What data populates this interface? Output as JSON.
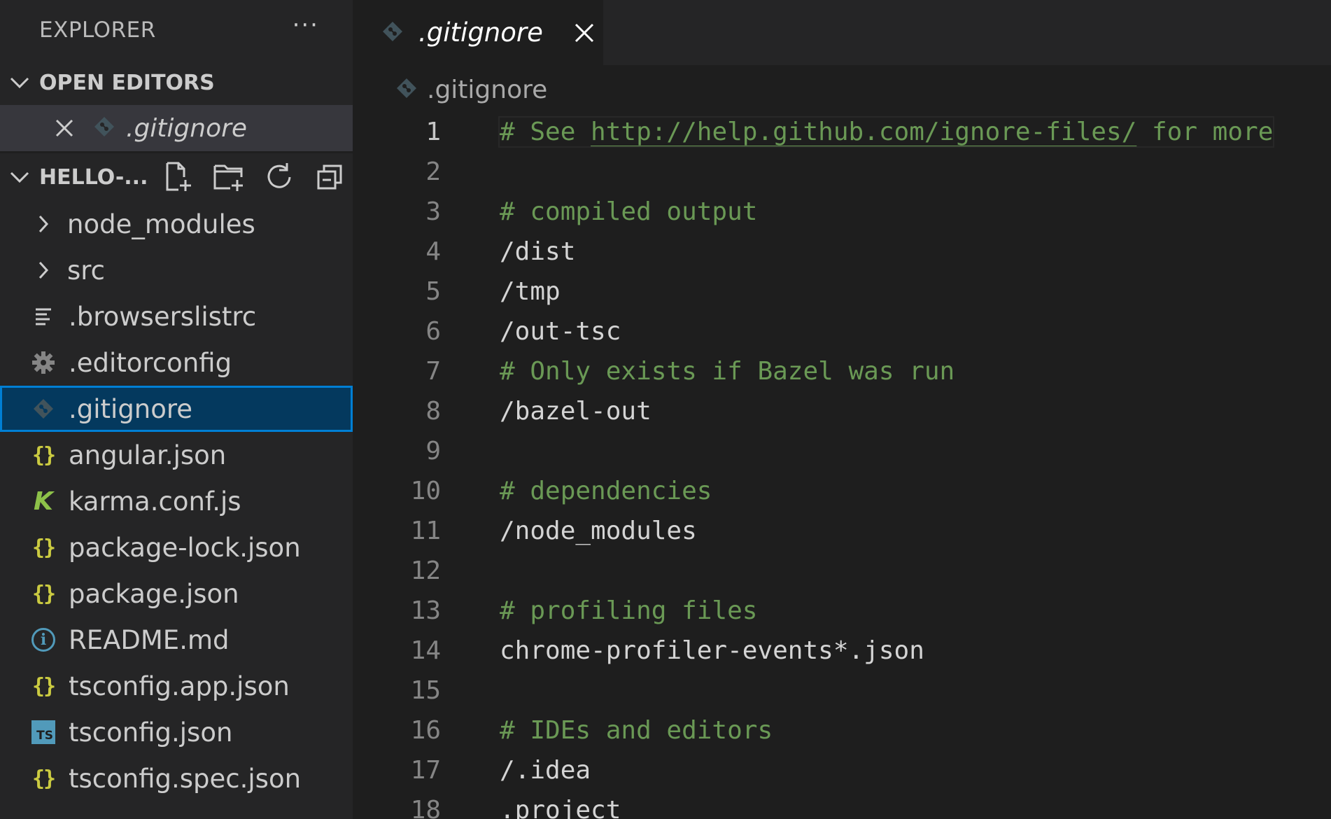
{
  "sidebar": {
    "title": "EXPLORER",
    "more_label": "···",
    "open_editors": {
      "header": "OPEN EDITORS",
      "items": [
        {
          "name": ".gitignore"
        }
      ]
    },
    "project": {
      "header": "HELLO-...",
      "items": [
        {
          "name": "node_modules",
          "kind": "folder"
        },
        {
          "name": "src",
          "kind": "folder"
        },
        {
          "name": ".browserslistrc",
          "kind": "lines"
        },
        {
          "name": ".editorconfig",
          "kind": "gear"
        },
        {
          "name": ".gitignore",
          "kind": "git",
          "selected": true
        },
        {
          "name": "angular.json",
          "kind": "json"
        },
        {
          "name": "karma.conf.js",
          "kind": "karma"
        },
        {
          "name": "package-lock.json",
          "kind": "json"
        },
        {
          "name": "package.json",
          "kind": "json"
        },
        {
          "name": "README.md",
          "kind": "info"
        },
        {
          "name": "tsconfig.app.json",
          "kind": "json"
        },
        {
          "name": "tsconfig.json",
          "kind": "ts"
        },
        {
          "name": "tsconfig.spec.json",
          "kind": "json"
        }
      ]
    }
  },
  "editor": {
    "tab": {
      "label": ".gitignore"
    },
    "breadcrumb": ".gitignore",
    "lines": [
      {
        "n": "1",
        "comment": true,
        "prefix": "# See ",
        "link": "http://help.github.com/ignore-files/",
        "suffix": " for more"
      },
      {
        "n": "2",
        "text": ""
      },
      {
        "n": "3",
        "comment": true,
        "text": "# compiled output"
      },
      {
        "n": "4",
        "text": "/dist"
      },
      {
        "n": "5",
        "text": "/tmp"
      },
      {
        "n": "6",
        "text": "/out-tsc"
      },
      {
        "n": "7",
        "comment": true,
        "text": "# Only exists if Bazel was run"
      },
      {
        "n": "8",
        "text": "/bazel-out"
      },
      {
        "n": "9",
        "text": ""
      },
      {
        "n": "10",
        "comment": true,
        "text": "# dependencies"
      },
      {
        "n": "11",
        "text": "/node_modules"
      },
      {
        "n": "12",
        "text": ""
      },
      {
        "n": "13",
        "comment": true,
        "text": "# profiling files"
      },
      {
        "n": "14",
        "text": "chrome-profiler-events*.json"
      },
      {
        "n": "15",
        "text": ""
      },
      {
        "n": "16",
        "comment": true,
        "text": "# IDEs and editors"
      },
      {
        "n": "17",
        "text": "/.idea"
      },
      {
        "n": "18",
        "text": ".project"
      }
    ]
  },
  "colors": {
    "sidebar_bg": "#252526",
    "editor_bg": "#1e1e1e",
    "selection_bg": "#04395e",
    "selection_border": "#007fd4",
    "comment": "#6a9955",
    "json_icon": "#cbcb41",
    "karma_icon": "#8dc149",
    "info_icon": "#519aba",
    "git_icon": "#41535b"
  }
}
